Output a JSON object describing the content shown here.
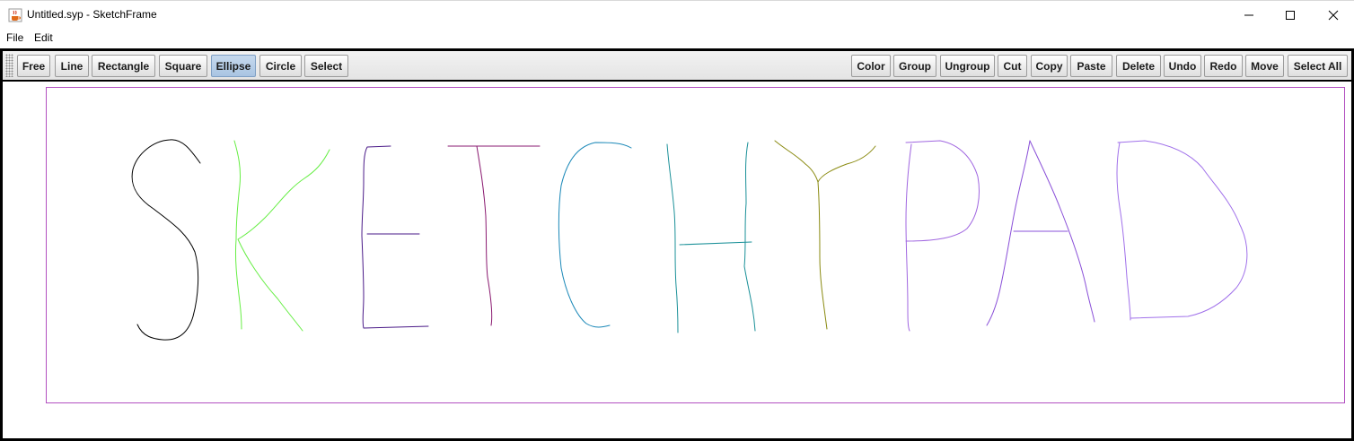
{
  "window": {
    "title": "Untitled.syp - SketchFrame",
    "app_icon": "java-cup-icon",
    "controls": [
      "minimize-icon",
      "maximize-icon",
      "close-icon"
    ]
  },
  "menubar": {
    "items": [
      "File",
      "Edit"
    ]
  },
  "toolbar": {
    "tools": [
      {
        "label": "Free",
        "active": false
      },
      {
        "label": "Line",
        "active": false
      },
      {
        "label": "Rectangle",
        "active": false
      },
      {
        "label": "Square",
        "active": false
      },
      {
        "label": "Ellipse",
        "active": true
      },
      {
        "label": "Circle",
        "active": false
      },
      {
        "label": "Select",
        "active": false
      }
    ],
    "actions": [
      "Color",
      "Group",
      "Ungroup",
      "Cut",
      "Copy",
      "Paste",
      "Delete",
      "Undo",
      "Redo",
      "Move",
      "Select All"
    ]
  },
  "canvas": {
    "border_shape": {
      "type": "rectangle",
      "color": "#b24fc0"
    },
    "strokes": [
      {
        "letter": "S",
        "color": "#000000"
      },
      {
        "letter": "K",
        "color": "#66ee44"
      },
      {
        "letter": "E",
        "color": "#4a1a88"
      },
      {
        "letter": "T",
        "color": "#8a1a70"
      },
      {
        "letter": "C",
        "color": "#1a88b8"
      },
      {
        "letter": "H",
        "color": "#1a9098"
      },
      {
        "letter": "Y",
        "color": "#8a8a10"
      },
      {
        "letter": "P",
        "color": "#a066e0"
      },
      {
        "letter": "A",
        "color": "#8a50d8"
      },
      {
        "letter": "D",
        "color": "#a070ea"
      }
    ]
  }
}
